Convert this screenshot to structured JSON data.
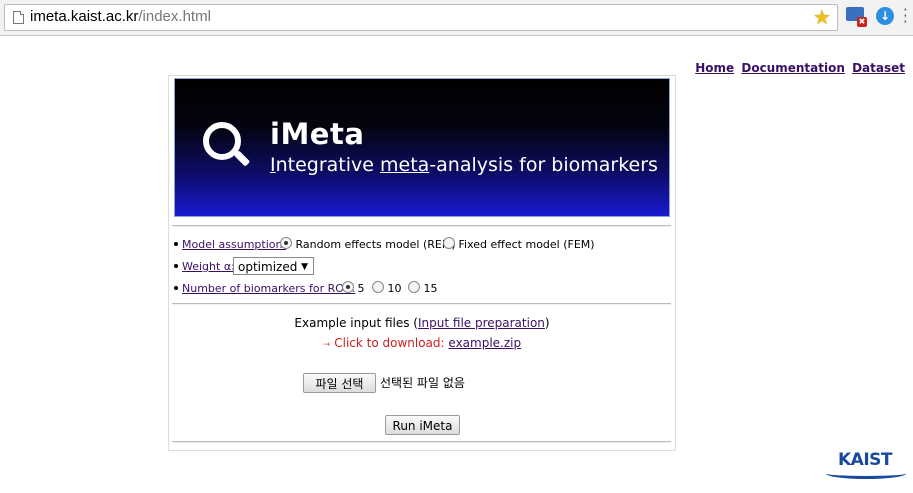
{
  "browser": {
    "url_host": "imeta.kaist.ac.kr",
    "url_path": "/index.html"
  },
  "nav": {
    "home": "Home",
    "documentation": "Documentation",
    "dataset": "Dataset"
  },
  "banner": {
    "title": "iMeta",
    "subtitle_parts": [
      "I",
      "ntegrative ",
      "meta",
      "-analysis for biomarkers"
    ]
  },
  "options": {
    "model_label": "Model assumption:",
    "model_options": [
      {
        "label": "Random effects model (REM)",
        "selected": true
      },
      {
        "label": "Fixed effect model (FEM)",
        "selected": false
      }
    ],
    "weight_label": "Weight α:",
    "weight_value": "optimized",
    "roc_label": "Number of biomarkers for ROC:",
    "roc_options": [
      {
        "label": "5",
        "selected": true
      },
      {
        "label": "10",
        "selected": false
      },
      {
        "label": "15",
        "selected": false
      }
    ]
  },
  "example": {
    "prefix": "Example input files (",
    "link": "Input file preparation",
    "suffix": ")",
    "download_text": "Click to download:",
    "download_link": "example.zip"
  },
  "file": {
    "button": "파일 선택",
    "status": "선택된 파일 없음"
  },
  "run_button": "Run iMeta",
  "logo_text": "KAIST",
  "colors": {
    "link": "#3a1066",
    "banner_bottom": "#1a1ad0",
    "download_red": "#cc2020"
  }
}
